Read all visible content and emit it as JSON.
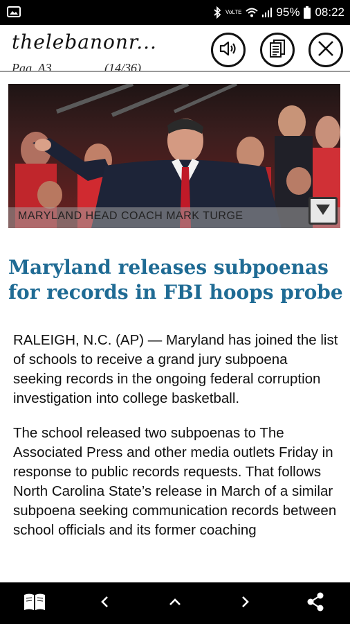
{
  "status_bar": {
    "battery_percent": "95%",
    "time": "08:22",
    "network_label": "VoLTE"
  },
  "header": {
    "title": "thelebanonr...",
    "page_label": "Pag. A3",
    "page_count": "(14/36)"
  },
  "photo": {
    "caption": "MARYLAND HEAD COACH MARK TURGE"
  },
  "article": {
    "headline": "Maryland releases subpoenas for records in FBI hoops probe",
    "paragraphs": [
      "RALEIGH, N.C. (AP) — Maryland has joined the list of schools to receive a grand jury subpoena seeking records in the ongoing federal corruption investigation into college basketball.",
      "The school released two subpoenas to The Associated Press and other media outlets Friday in response to public records requests. That follows North Carolina State’s release in March of a similar subpoena seeking communication records between school officials and its former coaching"
    ]
  },
  "icons": {
    "status_left": "image-icon",
    "sound": "speaker-icon",
    "pages": "pages-icon",
    "close": "close-icon",
    "expand": "triangle-down-icon",
    "nav": [
      "book-icon",
      "chevron-left-icon",
      "chevron-up-icon",
      "chevron-right-icon",
      "share-icon"
    ]
  },
  "colors": {
    "headline": "#1f6b94",
    "bars": "#000000"
  }
}
